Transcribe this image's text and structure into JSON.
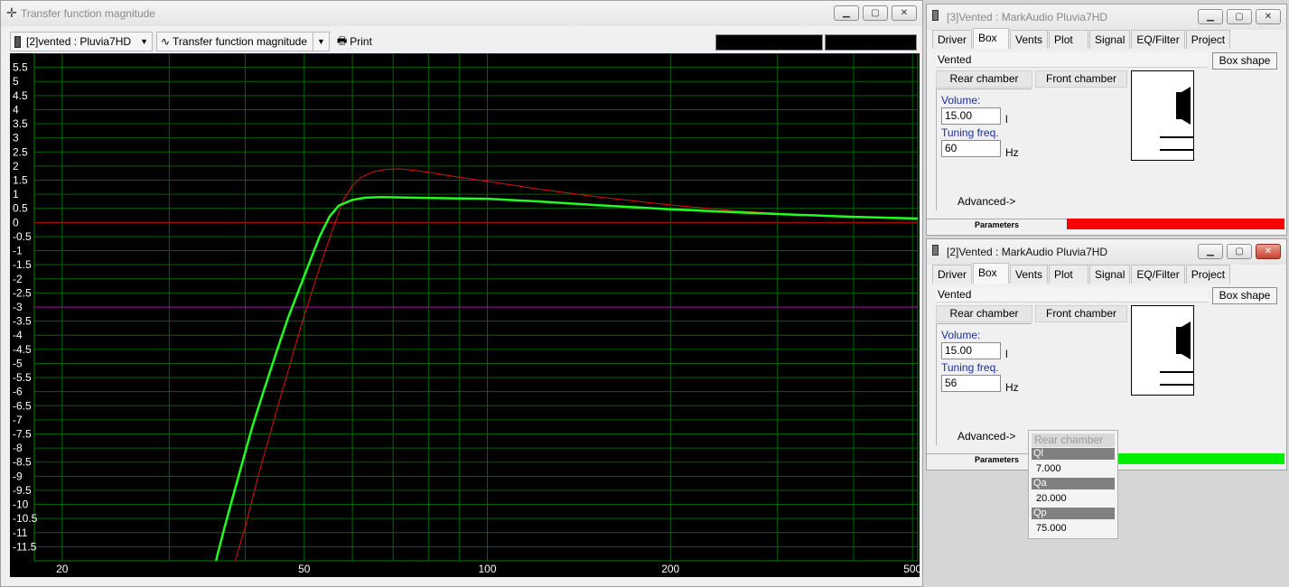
{
  "main": {
    "title": "Transfer function magnitude",
    "driver_select": "[2]vented : Pluvia7HD",
    "graph_select": "Transfer function magnitude",
    "print_label": "Print"
  },
  "chart_data": {
    "type": "line",
    "title": "",
    "xlabel": "",
    "ylabel": "",
    "xscale": "log",
    "xlim": [
      18,
      510
    ],
    "ylim": [
      -12,
      6
    ],
    "x_tick_labels": [
      "20",
      "50",
      "100",
      "200",
      "500"
    ],
    "x_ticks": [
      20,
      50,
      100,
      200,
      500
    ],
    "y_ticks": [
      5.5,
      5,
      4.5,
      4,
      3.5,
      3,
      2.5,
      2,
      1.5,
      1,
      0.5,
      0,
      -0.5,
      -1,
      -1.5,
      -2,
      -2.5,
      -3,
      -3.5,
      -4,
      -4.5,
      -5,
      -5.5,
      -6,
      -6.5,
      -7,
      -7.5,
      -8,
      -8.5,
      -9,
      -9.5,
      -10,
      -10.5,
      -11,
      -11.5
    ],
    "y_tick_labels": [
      "5.5",
      "5",
      "4.5",
      "4",
      "3.5",
      "3",
      "2.5",
      "2",
      "1.5",
      "1",
      "0.5",
      "0",
      "-0.5",
      "-1",
      "-1.5",
      "-2",
      "-2.5",
      "-3",
      "-3.5",
      "-4",
      "-4.5",
      "-5",
      "-5.5",
      "-6",
      "-6.5",
      "-7",
      "-7.5",
      "-8",
      "-8.5",
      "-9",
      "-9.5",
      "-10",
      "-10.5",
      "-11",
      "-11.5"
    ],
    "grid": true,
    "reference_lines": [
      {
        "y": 0,
        "color": "#c00000"
      },
      {
        "y": -3,
        "color": "#c000c0"
      }
    ],
    "series": [
      {
        "color": "#e01010",
        "width": 1,
        "points": [
          [
            38.5,
            -12
          ],
          [
            40,
            -10.8
          ],
          [
            42,
            -9
          ],
          [
            45,
            -6.7
          ],
          [
            48,
            -4.6
          ],
          [
            50,
            -3.3
          ],
          [
            53,
            -1.6
          ],
          [
            56,
            -0.1
          ],
          [
            58,
            0.8
          ],
          [
            60,
            1.3
          ],
          [
            62,
            1.6
          ],
          [
            65,
            1.8
          ],
          [
            68,
            1.88
          ],
          [
            72,
            1.9
          ],
          [
            76,
            1.85
          ],
          [
            80,
            1.78
          ],
          [
            90,
            1.6
          ],
          [
            100,
            1.46
          ],
          [
            120,
            1.2
          ],
          [
            150,
            0.92
          ],
          [
            200,
            0.62
          ],
          [
            250,
            0.43
          ],
          [
            300,
            0.32
          ],
          [
            400,
            0.2
          ],
          [
            510,
            0.14
          ]
        ]
      },
      {
        "color": "#20ff20",
        "width": 2.5,
        "points": [
          [
            35.8,
            -12
          ],
          [
            37,
            -10.8
          ],
          [
            39,
            -9
          ],
          [
            41,
            -7.3
          ],
          [
            43,
            -5.9
          ],
          [
            45,
            -4.6
          ],
          [
            47,
            -3.4
          ],
          [
            50,
            -1.9
          ],
          [
            53,
            -0.5
          ],
          [
            55,
            0.2
          ],
          [
            57,
            0.6
          ],
          [
            60,
            0.8
          ],
          [
            63,
            0.88
          ],
          [
            67,
            0.9
          ],
          [
            75,
            0.88
          ],
          [
            90,
            0.85
          ],
          [
            100,
            0.84
          ],
          [
            120,
            0.75
          ],
          [
            150,
            0.62
          ],
          [
            200,
            0.47
          ],
          [
            250,
            0.37
          ],
          [
            300,
            0.3
          ],
          [
            400,
            0.2
          ],
          [
            510,
            0.14
          ]
        ]
      }
    ]
  },
  "w3": {
    "title": "[3]Vented : MarkAudio Pluvia7HD",
    "tabs": [
      "Driver",
      "Box",
      "Vents",
      "Plot",
      "Signal",
      "EQ/Filter",
      "Project"
    ],
    "box_type": "Vented",
    "box_shape_label": "Box shape",
    "rear_chamber_label": "Rear chamber",
    "front_chamber_label": "Front chamber",
    "volume_label": "Volume:",
    "volume_value": "15.00",
    "volume_unit": "l",
    "tuning_label": "Tuning freq.",
    "tuning_value": "60",
    "tuning_unit": "Hz",
    "advanced_label": "Advanced->",
    "parameters_label": "Parameters",
    "parameters_color": "#ff0000"
  },
  "w2": {
    "title": "[2]Vented : MarkAudio Pluvia7HD",
    "tabs": [
      "Driver",
      "Box",
      "Vents",
      "Plot",
      "Signal",
      "EQ/Filter",
      "Project"
    ],
    "box_type": "Vented",
    "box_shape_label": "Box shape",
    "rear_chamber_label": "Rear chamber",
    "front_chamber_label": "Front chamber",
    "volume_label": "Volume:",
    "volume_value": "15.00",
    "volume_unit": "l",
    "tuning_label": "Tuning freq.",
    "tuning_value": "56",
    "tuning_unit": "Hz",
    "advanced_label": "Advanced->",
    "parameters_label": "Parameters",
    "parameters_color": "#00ee00"
  },
  "popup": {
    "title": "Rear chamber",
    "ql_label": "Ql",
    "ql_value": "7.000",
    "qa_label": "Qa",
    "qa_value": "20.000",
    "qp_label": "Qp",
    "qp_value": "75.000"
  },
  "icons": {
    "main": "crosshair-icon",
    "driver": "speaker-icon",
    "graph": "sine-wave-icon",
    "print": "printer-icon"
  }
}
